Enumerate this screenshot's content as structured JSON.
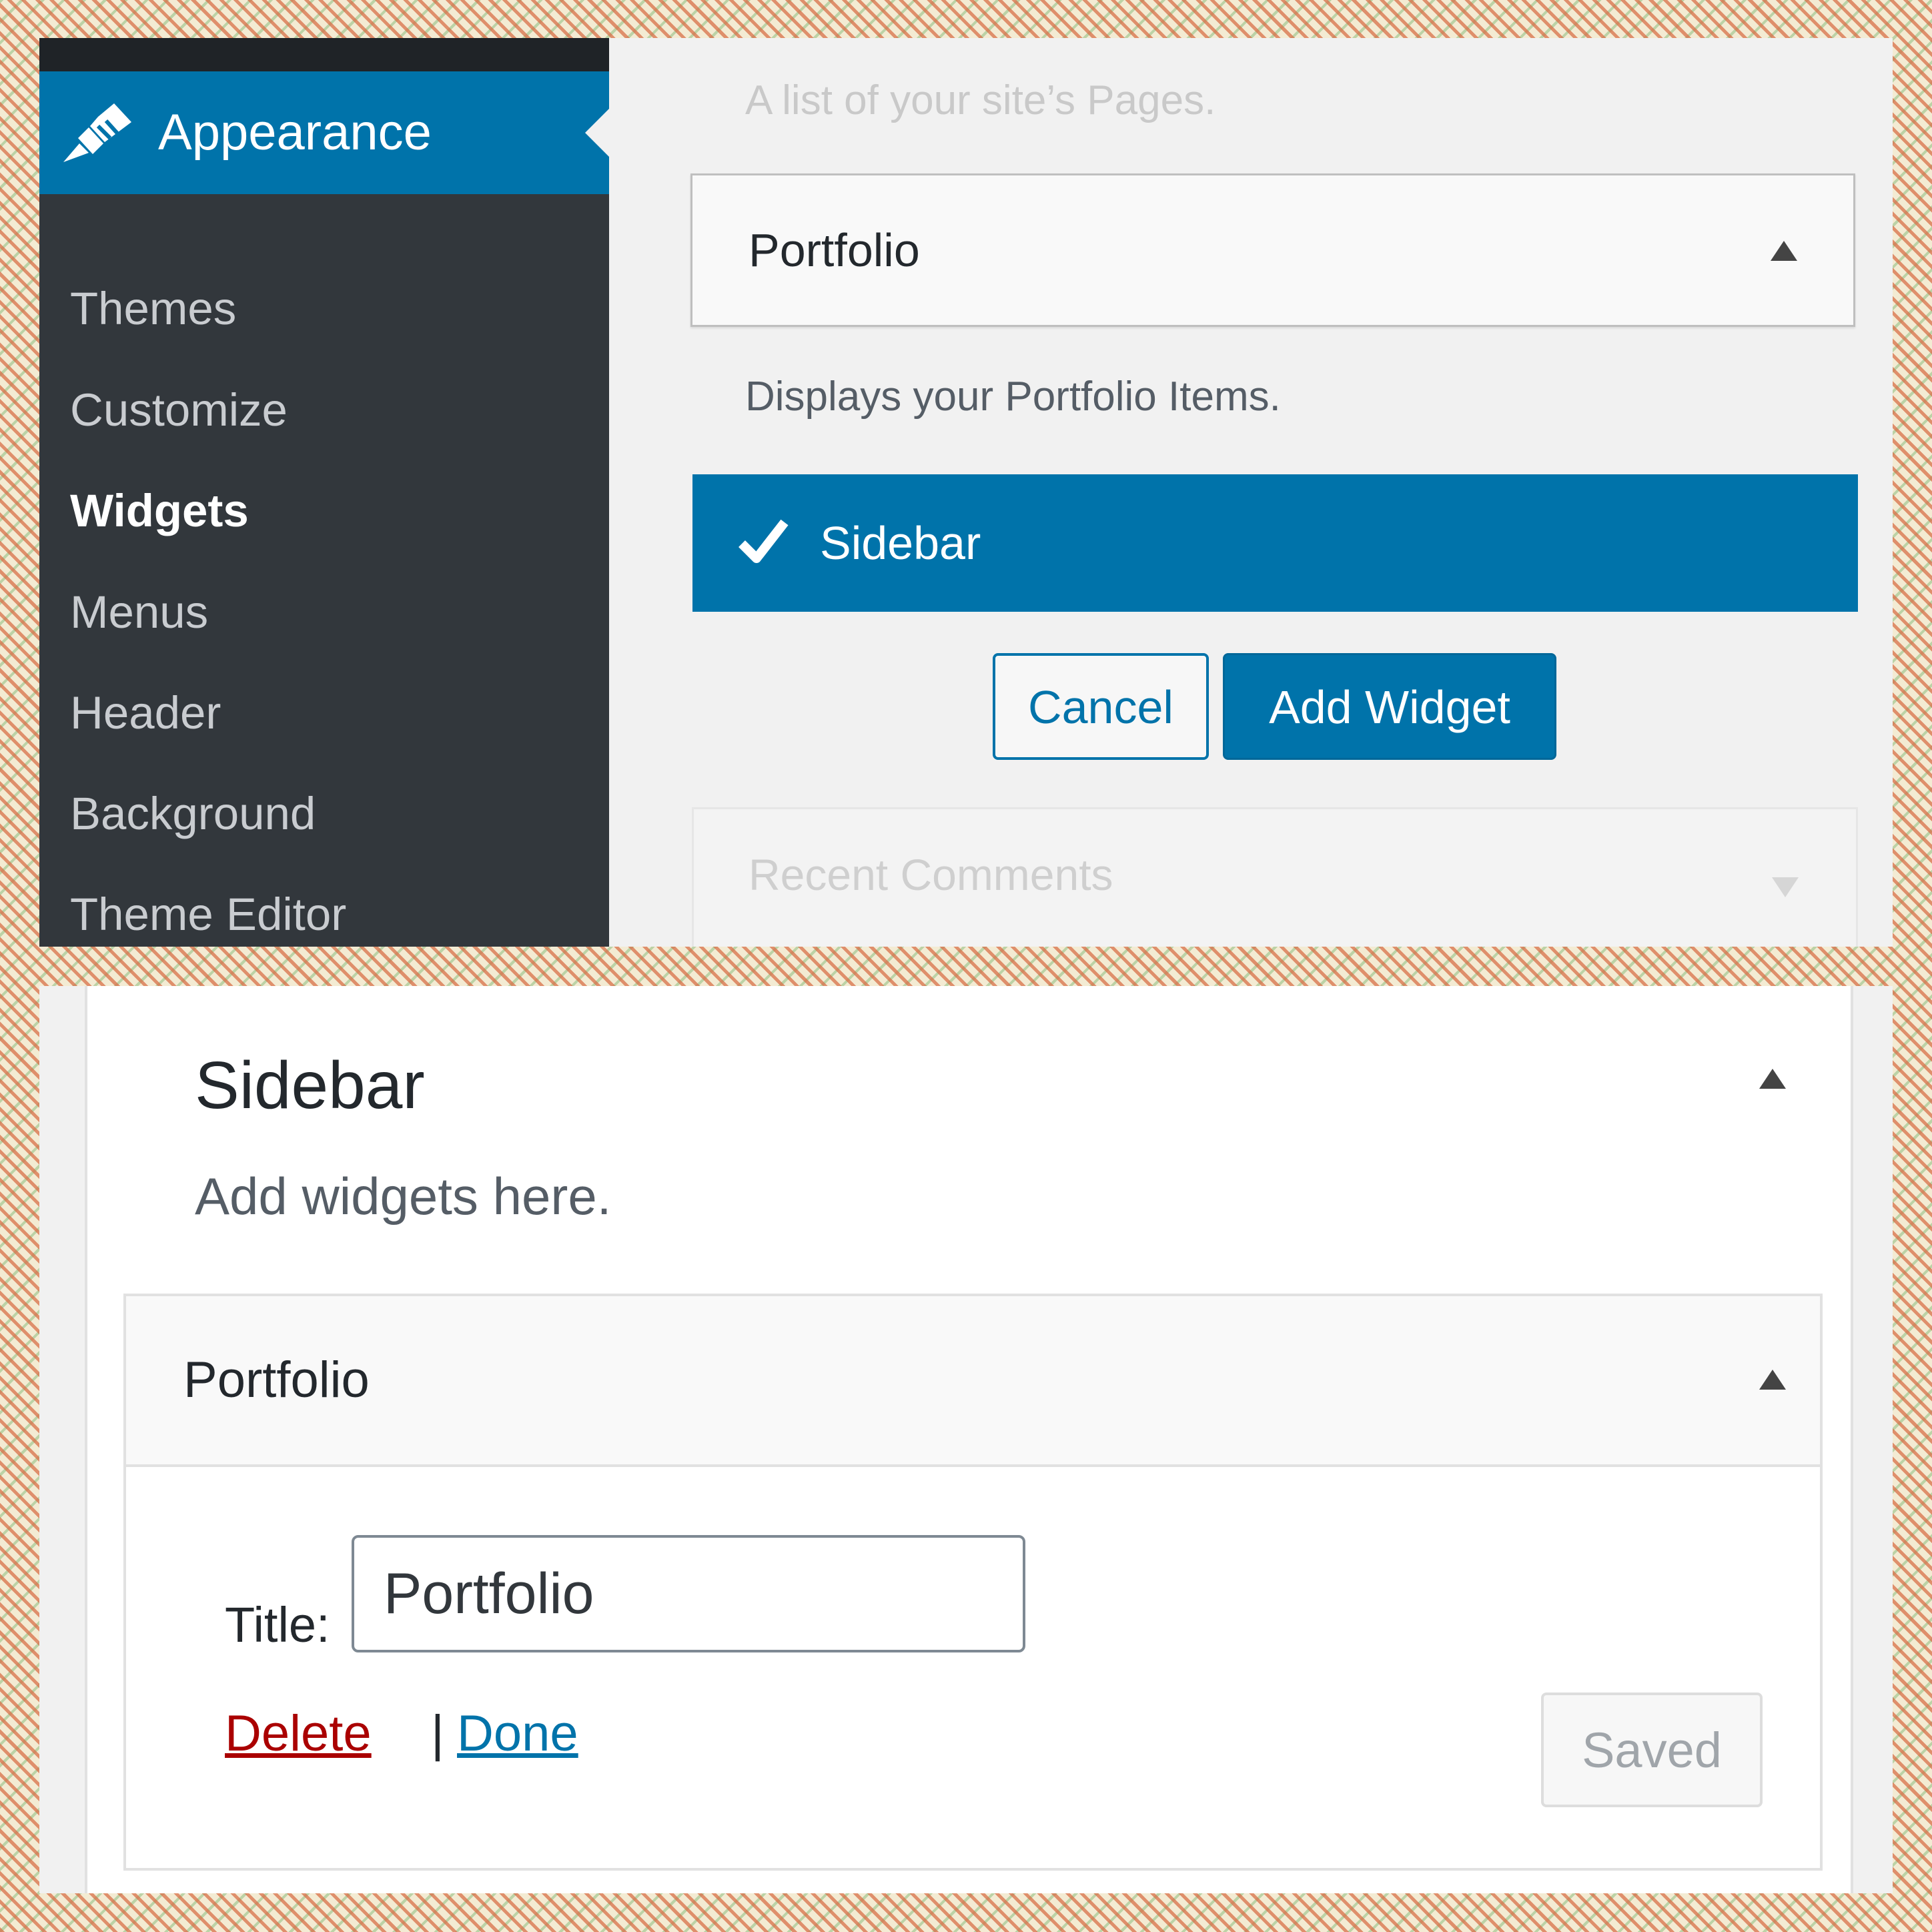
{
  "top": {
    "admin_menu": {
      "appearance_label": "Appearance",
      "items": [
        {
          "label": "Themes"
        },
        {
          "label": "Customize"
        },
        {
          "label": "Widgets",
          "current": true
        },
        {
          "label": "Menus"
        },
        {
          "label": "Header"
        },
        {
          "label": "Background"
        },
        {
          "label": "Theme Editor"
        }
      ]
    },
    "widget_chooser": {
      "prev_description": "A list of your site’s Pages.",
      "widget_title": "Portfolio",
      "widget_description": "Displays your Portfolio Items.",
      "selected_area": "Sidebar",
      "cancel_label": "Cancel",
      "add_label": "Add Widget",
      "next_widget_title": "Recent Comments"
    }
  },
  "bottom": {
    "area_title": "Sidebar",
    "area_description": "Add widgets here.",
    "widget": {
      "header_title": "Portfolio",
      "title_label": "Title:",
      "title_value": "Portfolio",
      "delete_label": "Delete",
      "separator": "|",
      "done_label": "Done",
      "saved_label": "Saved"
    }
  },
  "icons": {
    "appearance": "paintbrush-icon",
    "selected": "checkmark-icon",
    "collapse": "triangle-up-icon",
    "expand": "triangle-down-icon"
  },
  "colors": {
    "accent": "#0073aa",
    "menu_bg": "#32373c",
    "delete": "#aa0000"
  }
}
